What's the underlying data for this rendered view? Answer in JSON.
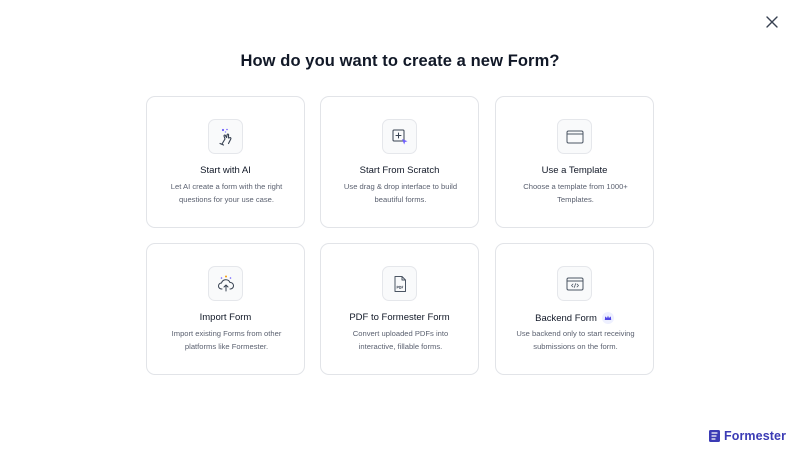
{
  "dialog": {
    "title": "How do you want to create a new Form?",
    "close_icon": "close-icon"
  },
  "options": [
    {
      "id": "start-with-ai",
      "icon": "ai-sparkle-hand-icon",
      "title": "Start with AI",
      "description": "Let AI create a form with the right questions for your use case."
    },
    {
      "id": "start-from-scratch",
      "icon": "cursor-add-icon",
      "title": "Start From Scratch",
      "description": "Use drag & drop interface to build beautiful forms."
    },
    {
      "id": "use-a-template",
      "icon": "template-window-icon",
      "title": "Use a Template",
      "description": "Choose a template from 1000+ Templates."
    },
    {
      "id": "import-form",
      "icon": "cloud-upload-icon",
      "title": "Import Form",
      "description": "Import existing Forms from other platforms like Formester."
    },
    {
      "id": "pdf-to-formester-form",
      "icon": "pdf-file-icon",
      "title": "PDF to Formester Form",
      "description": "Convert uploaded PDFs into interactive, fillable forms."
    },
    {
      "id": "backend-form",
      "icon": "code-window-icon",
      "title": "Backend Form",
      "badge_icon": "crown-icon",
      "description": "Use backend only to start receiving submissions on the form."
    }
  ],
  "brand": {
    "name": "Formester",
    "logo_icon": "formester-logo-icon",
    "color": "#3b3bb5"
  },
  "colors": {
    "accent": "#6d5dfc",
    "card_border": "#e2e4e8"
  }
}
